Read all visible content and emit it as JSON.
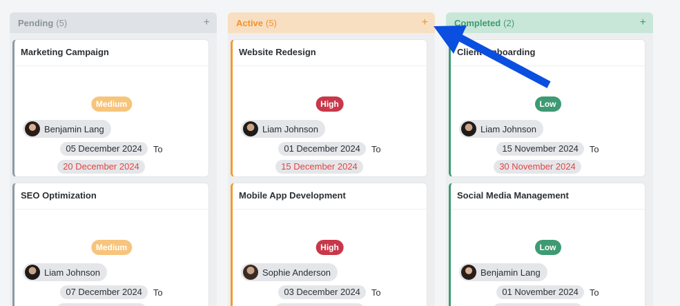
{
  "columns": [
    {
      "id": "pending",
      "title": "Pending",
      "count": "(5)",
      "add": "+",
      "cards": [
        {
          "title": "Marketing Campaign",
          "priority": "Medium",
          "assignee": "Benjamin Lang",
          "start": "05 December 2024",
          "to": "To",
          "end": "20 December 2024"
        },
        {
          "title": "SEO Optimization",
          "priority": "Medium",
          "assignee": "Liam Johnson",
          "start": "07 December 2024",
          "to": "To",
          "end": ""
        }
      ]
    },
    {
      "id": "active",
      "title": "Active",
      "count": "(5)",
      "add": "+",
      "cards": [
        {
          "title": "Website Redesign",
          "priority": "High",
          "assignee": "Liam Johnson",
          "start": "01 December 2024",
          "to": "To",
          "end": "15 December 2024"
        },
        {
          "title": "Mobile App Development",
          "priority": "High",
          "assignee": "Sophie Anderson",
          "start": "03 December 2024",
          "to": "To",
          "end": ""
        }
      ]
    },
    {
      "id": "completed",
      "title": "Completed",
      "count": "(2)",
      "add": "+",
      "cards": [
        {
          "title": "Client Onboarding",
          "priority": "Low",
          "assignee": "Liam Johnson",
          "start": "15 November 2024",
          "to": "To",
          "end": "30 November 2024"
        },
        {
          "title": "Social Media Management",
          "priority": "Low",
          "assignee": "Benjamin Lang",
          "start": "01 November 2024",
          "to": "To",
          "end": ""
        }
      ]
    }
  ],
  "colors": {
    "pending": "#8b9aa5",
    "active": "#f39a2c",
    "completed": "#3e9a72",
    "arrow": "#0a4fe0",
    "overdue": "#e04545"
  },
  "icons": {
    "add": "plus-icon",
    "annotation": "arrow-pointer-icon"
  }
}
